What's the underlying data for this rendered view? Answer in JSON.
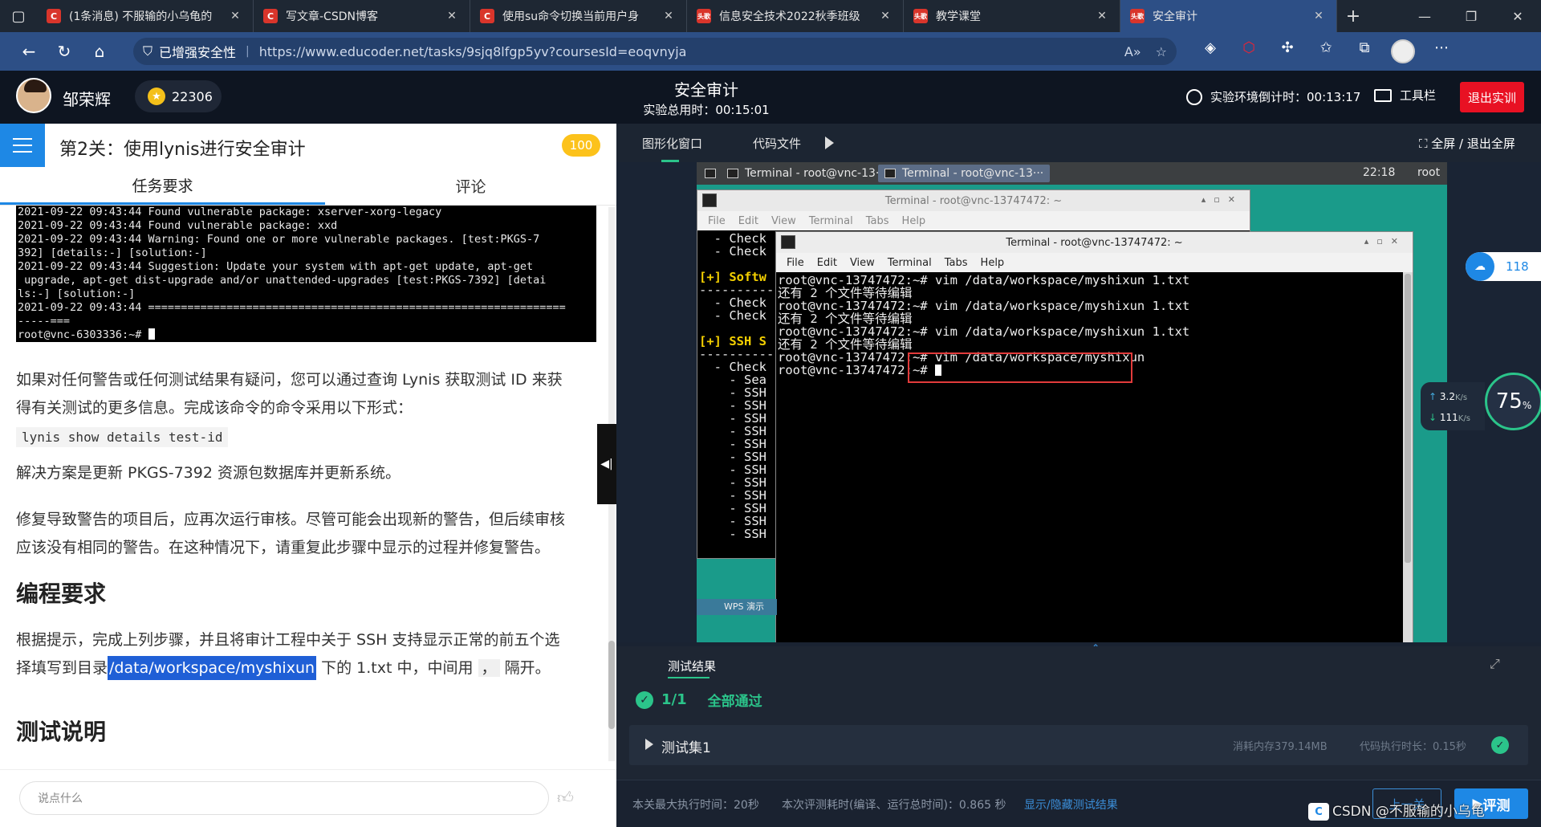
{
  "browser": {
    "tabs": [
      {
        "label": "(1条消息) 不服输的小乌龟的",
        "icon": "C",
        "color": "#d9352b"
      },
      {
        "label": "写文章-CSDN博客",
        "icon": "C",
        "color": "#d9352b"
      },
      {
        "label": "使用su命令切换当前用户身",
        "icon": "C",
        "color": "#d9352b"
      },
      {
        "label": "信息安全技术2022秋季班级",
        "icon": "头歌",
        "color": "#c0392b"
      },
      {
        "label": "教学课堂",
        "icon": "头歌",
        "color": "#c0392b"
      },
      {
        "label": "安全审计",
        "icon": "头歌",
        "color": "#c0392b",
        "active": true
      }
    ],
    "security_label": "已增强安全性",
    "url": "https://www.educoder.net/tasks/9sjq8lfgp5yv?coursesId=eoqvnyja"
  },
  "header": {
    "username": "邹荣辉",
    "coins": "22306",
    "page_title": "安全审计",
    "total_time": "实验总用时：00:15:01",
    "countdown": "实验环境倒计时：00:13:17",
    "toolbar_label": "工具栏",
    "exit_label": "退出实训"
  },
  "left": {
    "level_title": "第2关：使用lynis进行安全审计",
    "score": "100",
    "tab_task": "任务要求",
    "tab_comment": "评论",
    "code_lines": [
      "2021-09-22 09:43:44 Found vulnerable package: xserver-xorg-legacy",
      "2021-09-22 09:43:44 Found vulnerable package: xxd",
      "2021-09-22 09:43:44 Warning: Found one or more vulnerable packages. [test:PKGS-7",
      "392] [details:-] [solution:-]",
      "2021-09-22 09:43:44 Suggestion: Update your system with apt-get update, apt-get",
      " upgrade, apt-get dist-upgrade and/or unattended-upgrades [test:PKGS-7392] [detai",
      "ls:-] [solution:-]",
      "2021-09-22 09:43:44 ================================================================",
      "-----===",
      "root@vnc-6303336:~# "
    ],
    "para1_line1": "如果对任何警告或任何测试结果有疑问，您可以通过查询 Lynis 获取测试 ID 来获",
    "para1_line2": "得有关测试的更多信息。完成该命令的命令采用以下形式：",
    "inline_code": "lynis show details test-id",
    "para2": "解决方案是更新 PKGS-7392 资源包数据库并更新系统。",
    "para3_line1": "修复导致警告的项目后，应再次运行审核。尽管可能会出现新的警告，但后续审核",
    "para3_line2": "应该没有相同的警告。在这种情况下，请重复此步骤中显示的过程并修复警告。",
    "heading_programming": "编程要求",
    "para4_line1": "根据提示，完成上列步骤，并且将审计工程中关于 SSH 支持显示正常的前五个选",
    "para4_line2a": "择填写到目录",
    "para4_highlight": "/data/workspace/myshixun",
    "para4_line2b": "下的 1.txt 中，中间用",
    "para4_sep": "，",
    "para4_line2c": "隔开。",
    "heading_test": "测试说明",
    "comment_placeholder": "说点什么"
  },
  "right": {
    "tab_graphic": "图形化窗口",
    "tab_code": "代码文件",
    "fullscreen": "全屏 / 退出全屏",
    "vnc": {
      "task1": "Terminal - root@vnc-13···",
      "task2": "Terminal - root@vnc-13···",
      "clock": "22:18",
      "user": "root",
      "back_title": "Terminal - root@vnc-13747472: ~",
      "front_title": "Terminal - root@vnc-13747472: ~",
      "menu": [
        "File",
        "Edit",
        "View",
        "Terminal",
        "Tabs",
        "Help"
      ],
      "back_lines": [
        "  - Check",
        "  - Check",
        "",
        "[+] Softw",
        "----------",
        "  - Check",
        "  - Check",
        "",
        "[+] SSH S",
        "----------",
        "  - Check",
        "    - Sea",
        "    - SSH",
        "    - SSH",
        "    - SSH",
        "    - SSH",
        "    - SSH",
        "    - SSH",
        "    - SSH",
        "    - SSH",
        "    - SSH",
        "    - SSH",
        "    - SSH",
        "    - SSH"
      ],
      "front_lines": [
        "root@vnc-13747472:~# vim /data/workspace/myshixun 1.txt",
        "还有 2 个文件等待编辑",
        "root@vnc-13747472:~# vim /data/workspace/myshixun 1.txt",
        "还有 2 个文件等待编辑",
        "root@vnc-13747472:~# vim /data/workspace/myshixun 1.txt",
        "还有 2 个文件等待编辑",
        "root@vnc-13747472:~# vim /data/workspace/myshixun",
        "root@vnc-13747472:~# "
      ],
      "wps_label": "WPS 演示"
    },
    "net": {
      "up": "3.2",
      "down": "111",
      "unit": "K/s",
      "percent": "75",
      "pct_sign": "%"
    },
    "cloud_count": "118",
    "results": {
      "title": "测试结果",
      "pass_count": "1/1",
      "pass_label": "全部通过",
      "set_name": "测试集1",
      "memory": "消耗内存379.14MB",
      "exec_time": "代码执行时长：0.15秒",
      "max_time": "本关最大执行时间：20秒",
      "eval_time": "本次评测耗时(编译、运行总时间)：0.865 秒",
      "toggle": "显示/隐藏测试结果",
      "prev": "上一关",
      "evaluate": "评测"
    }
  },
  "watermark": "CSDN @不服输的小乌龟"
}
